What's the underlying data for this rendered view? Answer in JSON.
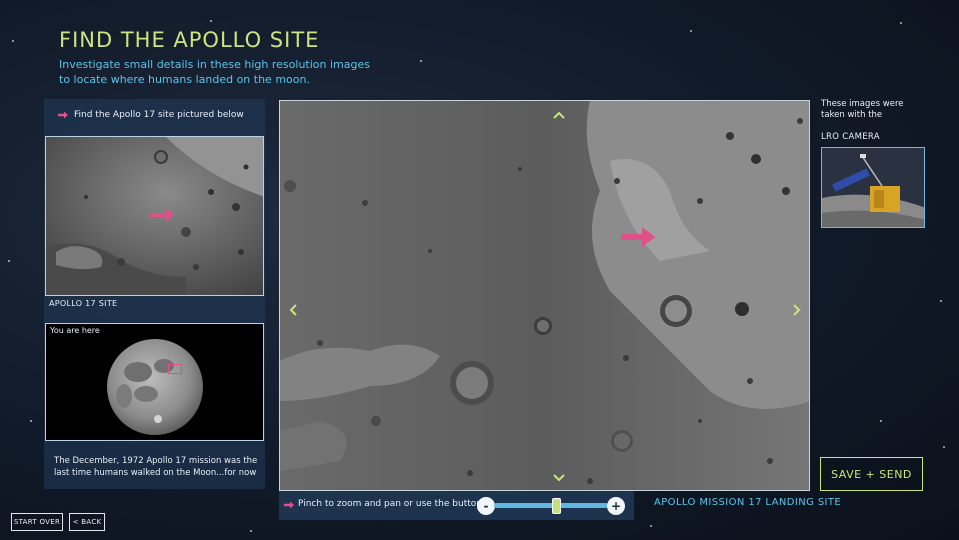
{
  "header": {
    "title": "FIND THE APOLLO SITE",
    "subtitle": "Investigate small details in these high resolution images to locate where humans landed on the moon."
  },
  "left_panel": {
    "instruction": "Find the Apollo 17 site pictured below",
    "site_caption": "APOLLO 17 SITE",
    "minimap_label": "You are here",
    "mission_text": "The December, 1972 Apollo 17 mission was the last time humans walked on the Moon...for now"
  },
  "main": {
    "nav_up": "^",
    "nav_down": "v",
    "nav_left": "<",
    "nav_right": ">"
  },
  "zoom_bar": {
    "instruction": "Pinch to zoom and pan or use the buttons",
    "zoom_out_label": "-",
    "zoom_in_label": "+",
    "zoom_level_fraction": 0.55
  },
  "mission_caption": "APOLLO MISSION 17 LANDING SITE",
  "right_panel": {
    "info_text": "These images were taken with the",
    "camera_label": "LRO CAMERA"
  },
  "buttons": {
    "save_send": "SAVE + SEND",
    "start_over": "START OVER",
    "back": "< BACK"
  },
  "colors": {
    "accent_green": "#c8e67c",
    "accent_blue": "#5fc3e8",
    "arrow_pink": "#e0508a",
    "panel_bg": "#223c5c"
  },
  "icons": {
    "instruction_arrow": "pink-arrow-icon",
    "location_marker": "pink-arrow-icon",
    "nav": [
      "chevron-up-icon",
      "chevron-down-icon",
      "chevron-left-icon",
      "chevron-right-icon"
    ]
  }
}
